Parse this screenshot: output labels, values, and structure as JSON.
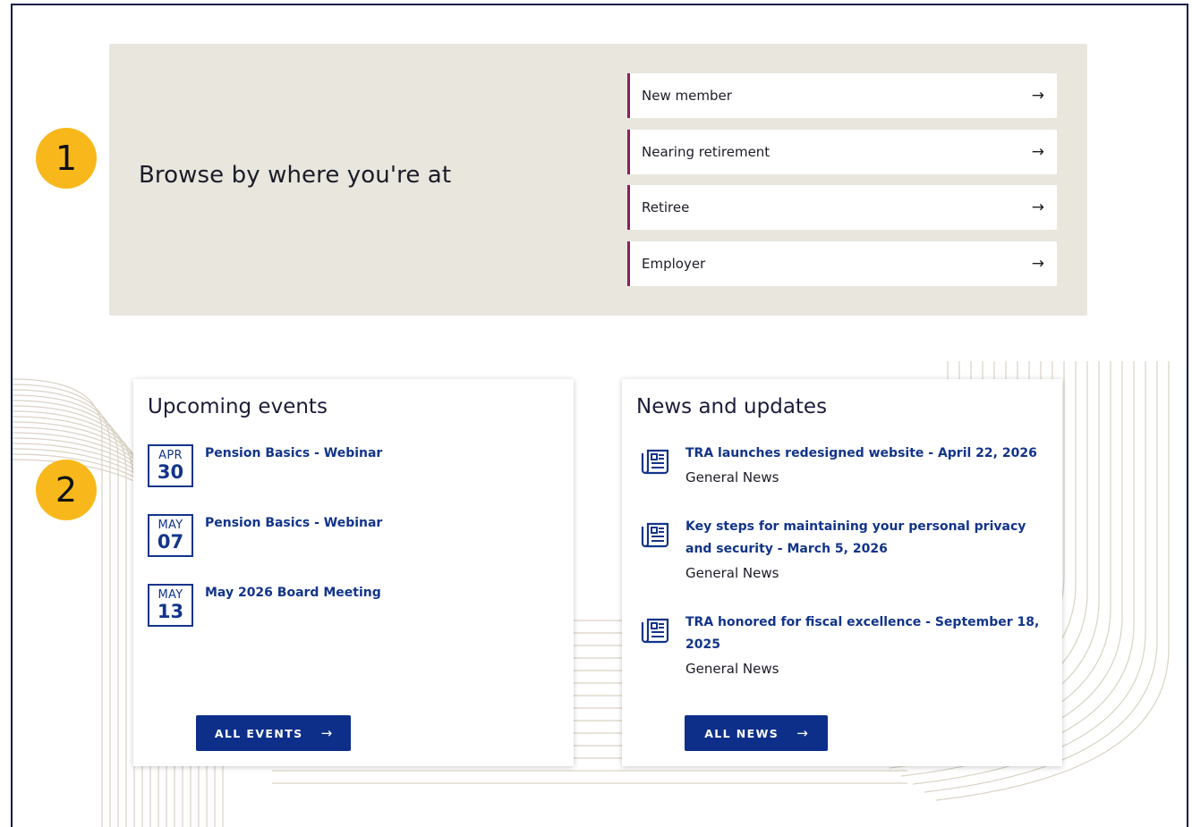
{
  "browse": {
    "title": "Browse by where you're at",
    "items": [
      {
        "label": "New member",
        "icon": "arrow-right-icon",
        "glyph": "→"
      },
      {
        "label": "Nearing retirement",
        "icon": "arrow-right-icon",
        "glyph": "→"
      },
      {
        "label": "Retiree",
        "icon": "arrow-right-icon",
        "glyph": "→"
      },
      {
        "label": "Employer",
        "icon": "arrow-right-icon",
        "glyph": "→"
      }
    ]
  },
  "badges": [
    "1",
    "2"
  ],
  "events": {
    "title": "Upcoming events",
    "items": [
      {
        "month": "APR",
        "day": "30",
        "title": "Pension Basics - Webinar"
      },
      {
        "month": "MAY",
        "day": "07",
        "title": "Pension Basics - Webinar"
      },
      {
        "month": "MAY",
        "day": "13",
        "title": "May 2026 Board Meeting"
      }
    ],
    "button": "ALL EVENTS",
    "button_glyph": "→"
  },
  "news": {
    "title": "News and updates",
    "items": [
      {
        "title": "TRA launches redesigned website - April 22, 2026",
        "category": "General News"
      },
      {
        "title": "Key steps for maintaining your personal privacy and security - March 5, 2026",
        "category": "General News"
      },
      {
        "title": "TRA honored for fiscal excellence - September 18, 2025",
        "category": "General News"
      }
    ],
    "button": "ALL NEWS",
    "button_glyph": "→"
  },
  "colors": {
    "frame": "#0d1b4a",
    "panel_bg": "#e8e6dd",
    "accent_magenta": "#8c1d5c",
    "link_blue": "#12348a",
    "button_blue": "#0d2f8a",
    "badge_yellow": "#f8b81c",
    "deco_line": "#d9d3c4"
  }
}
